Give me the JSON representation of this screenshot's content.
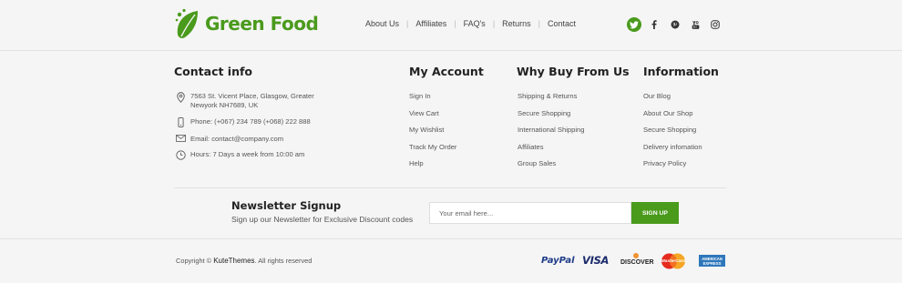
{
  "brand": {
    "name": "Green Food",
    "icon": "leaf-logo",
    "color": "#4a9a1c"
  },
  "topnav": [
    "About Us",
    "Affiliates",
    "FAQ's",
    "Returns",
    "Contact"
  ],
  "social": [
    "twitter-icon",
    "facebook-icon",
    "pinterest-icon",
    "youtube-icon",
    "instagram-icon"
  ],
  "contact": {
    "title": "Contact info",
    "address_line1": "7563 St. Vicent Place, Glasgow, Greater",
    "address_line2": "Newyork NH7689, UK",
    "phone": "Phone: (+067) 234 789  (+068) 222 888",
    "email": "Email:  contact@company.com",
    "hours": "Hours: 7 Days a week from 10:00 am"
  },
  "columns": [
    {
      "title": "My Account",
      "links": [
        "Sign In",
        "View Cart",
        "My Wishlist",
        "Track My Order",
        "Help"
      ]
    },
    {
      "title": "Why Buy From Us",
      "links": [
        "Shipping & Returns",
        "Secure Shopping",
        "International Shipping",
        "Affiliates",
        "Group Sales"
      ]
    },
    {
      "title": "Information",
      "links": [
        "Our Blog",
        "About Our Shop",
        "Secure Shopping",
        "Delivery infomation",
        "Privacy Policy"
      ]
    }
  ],
  "newsletter": {
    "title": "Newsletter Signup",
    "subtitle": "Sign up our Newsletter for Exclusive Discount codes",
    "placeholder": "Your email here...",
    "button": "SIGN UP"
  },
  "copyright": {
    "prefix": "Copyright © ",
    "brand": "KuteThemes",
    "suffix": ". All rights reserved"
  },
  "payments": {
    "paypal": "PayPal",
    "visa": "VISA",
    "discover": "DISCOVER",
    "mastercard": "MasterCard",
    "amex_line1": "AMERICAN",
    "amex_line2": "EXPRESS"
  },
  "accent_color": "#4a9a1c"
}
